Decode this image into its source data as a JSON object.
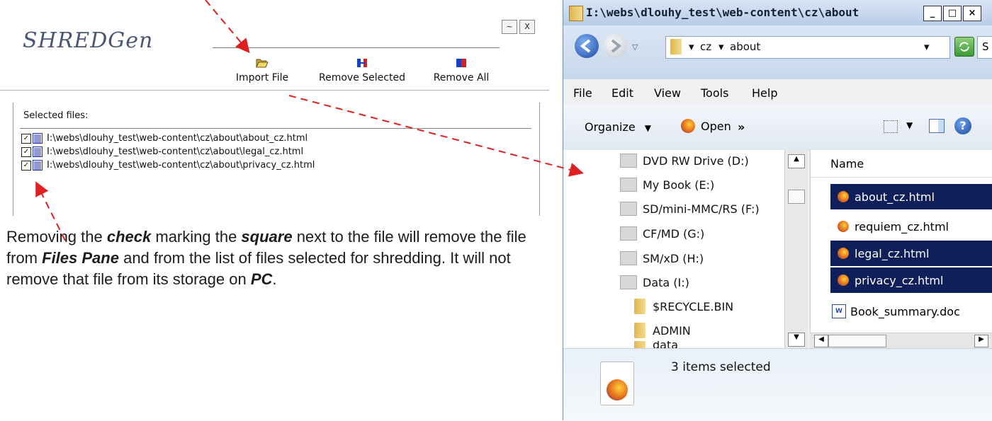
{
  "shredgen": {
    "logo_text": "SHREDGen",
    "window_buttons": [
      "~",
      "X"
    ],
    "toolbar": {
      "import_label": "Import File",
      "remove_selected_label": "Remove Selected",
      "remove_all_label": "Remove All"
    },
    "files_panel": {
      "label": "Selected files:",
      "files": [
        {
          "path": "I:\\webs\\dlouhy_test\\web-content\\cz\\about\\about_cz.html",
          "checked": true
        },
        {
          "path": "I:\\webs\\dlouhy_test\\web-content\\cz\\about\\legal_cz.html",
          "checked": true
        },
        {
          "path": "I:\\webs\\dlouhy_test\\web-content\\cz\\about\\privacy_cz.html",
          "checked": true
        }
      ]
    }
  },
  "caption": {
    "t1": "Removing the ",
    "check": "check",
    "t2": " marking the ",
    "square": "square",
    "t3": " next to the file will remove the file from ",
    "files_pane": "Files Pane",
    "t4": " and from the list of files selected for shredding. It will not remove that file from its storage on ",
    "pc": "PC",
    "t5": "."
  },
  "explorer": {
    "title": "I:\\webs\\dlouhy_test\\web-content\\cz\\about",
    "address": {
      "crumb1": "cz",
      "crumb2": "about",
      "search_partial": "S"
    },
    "menu": [
      "File",
      "Edit",
      "View",
      "Tools",
      "Help"
    ],
    "commands": {
      "organize": "Organize",
      "open": "Open",
      "more": "»"
    },
    "nav_items": [
      {
        "label": "DVD RW Drive (D:)",
        "icon": "dvd-drive-icon"
      },
      {
        "label": "My Book (E:)",
        "icon": "usb-drive-icon"
      },
      {
        "label": "SD/mini-MMC/RS (F:)",
        "icon": "card-reader-icon"
      },
      {
        "label": "CF/MD (G:)",
        "icon": "card-reader-icon"
      },
      {
        "label": "SM/xD (H:)",
        "icon": "card-reader-icon"
      },
      {
        "label": "Data (I:)",
        "icon": "usb-drive-icon"
      },
      {
        "label": "$RECYCLE.BIN",
        "icon": "folder-icon"
      },
      {
        "label": "ADMIN",
        "icon": "folder-icon"
      },
      {
        "label": "data",
        "icon": "folder-icon"
      }
    ],
    "column_header": "Name",
    "files": [
      {
        "name": "about_cz.html",
        "selected": true
      },
      {
        "name": "requiem_cz.html",
        "selected": false
      },
      {
        "name": "legal_cz.html",
        "selected": true
      },
      {
        "name": "privacy_cz.html",
        "selected": true
      },
      {
        "name": "Book_summary.doc",
        "selected": false
      }
    ],
    "status": "3 items selected"
  },
  "colors": {
    "annotation_arrow": "#e02020",
    "selection": "#0f1f5a",
    "logo": "#4a5674"
  }
}
